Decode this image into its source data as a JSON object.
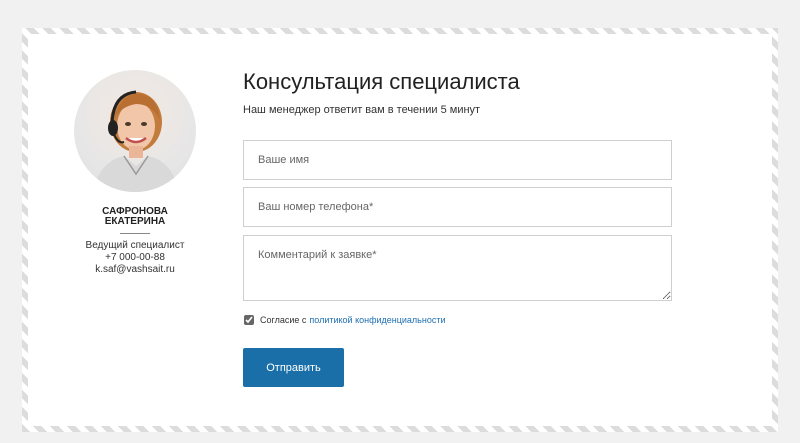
{
  "specialist": {
    "name_line1": "САФРОНОВА",
    "name_line2": "ЕКАТЕРИНА",
    "role": "Ведущий специалист",
    "phone": "+7 000-00-88",
    "email": "k.saf@vashsait.ru"
  },
  "form": {
    "title": "Консультация специалиста",
    "subtitle": "Наш менеджер ответит вам в течении 5 минут",
    "name_placeholder": "Ваше имя",
    "phone_placeholder": "Ваш номер телефона*",
    "comment_placeholder": "Комментарий к заявке*",
    "consent_text": "Согласие с",
    "consent_link": "политикой конфиденциальности",
    "consent_checked": true,
    "submit_label": "Отправить"
  }
}
